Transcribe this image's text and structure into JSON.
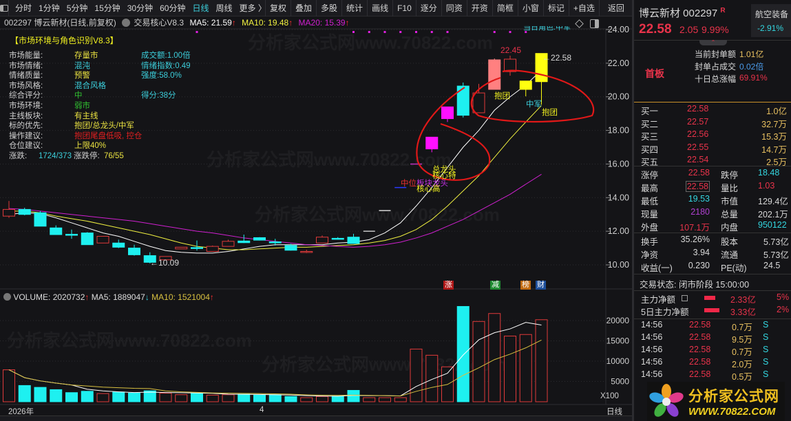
{
  "toolbar": {
    "periods": [
      "分时",
      "1分钟",
      "5分钟",
      "15分钟",
      "30分钟",
      "60分钟",
      "日线",
      "周线",
      "更多 〉"
    ],
    "active_period": "日线",
    "buttons": [
      "复权",
      "叠加",
      "多股",
      "统计",
      "画线",
      "F10",
      "逐分",
      "同资",
      "开资",
      "简框",
      "小窗",
      "标记",
      "+自选"
    ],
    "back": "返回"
  },
  "info": {
    "title": "002297 博云新材(日线,前复权)",
    "indicator": "交易核心V8.3",
    "ma5": "MA5: 21.59",
    "ma10": "MA10: 19.48",
    "ma20": "MA20: 15.39",
    "arrow": "↑"
  },
  "panel": {
    "title": "【市场环境与角色识别V8.3】",
    "rows": [
      {
        "label": "市场能量:",
        "value": "存量市",
        "vcolor": "#e8e040",
        "extra": "成交额:1.00倍"
      },
      {
        "label": "市场情绪:",
        "value": "混沌",
        "vcolor": "#3ccfdc",
        "extra": "情绪指数:0.49"
      },
      {
        "label": "情绪质量:",
        "value": "预警",
        "vcolor": "#e8e040",
        "extra": "强度:58.0%"
      },
      {
        "label": "市场风格:",
        "value": "混合风格",
        "vcolor": "#3ccfdc",
        "extra": ""
      },
      {
        "label": "综合评分:",
        "value": "中",
        "vcolor": "#30c030",
        "extra": "得分:38分"
      },
      {
        "label": "市场环境:",
        "value": "弱市",
        "vcolor": "#30c030",
        "extra": ""
      },
      {
        "label": "主线板块:",
        "value": "有主线",
        "vcolor": "#e8e040",
        "extra": ""
      },
      {
        "label": "标的优先:",
        "value": "抱团/总龙头/中军",
        "vcolor": "#e8e040",
        "extra": ""
      },
      {
        "label": "操作建议:",
        "value": "抱团尾盘低吸, 控仓",
        "vcolor": "#e02020",
        "extra": ""
      },
      {
        "label": "仓位建议:",
        "value": "上限40%",
        "vcolor": "#e8e040",
        "extra": ""
      }
    ],
    "updown_label": "涨跌:",
    "updown_value": "1724/373",
    "limit_label": "涨跌停:",
    "limit_value": "76/55"
  },
  "annotations": {
    "high_label": "22.45",
    "last_label": "22.58",
    "low_label": "10.09",
    "top_role": "当日角色:中军",
    "baotuan1": "抱团",
    "zhongjun": "中军",
    "baotuan2": "抱团",
    "zonglongtou": "总龙头",
    "hexinte": "核心特",
    "zhongwei": "中位",
    "bankuai": "板块龙头",
    "hexingao": "核心高"
  },
  "volume_header": {
    "volume": "VOLUME: 2020732",
    "ma5": "MA5: 1889047",
    "ma10": "MA10: 1521004",
    "up": "↑",
    "down": "↓"
  },
  "event_tags": [
    {
      "text": "涨",
      "color": "#b01818"
    },
    {
      "text": "减",
      "color": "#1d8a30"
    },
    {
      "text": "榜",
      "color": "#c06a10"
    },
    {
      "text": "财",
      "color": "#1d4e9a"
    }
  ],
  "xaxis": {
    "year": "2026年",
    "month": "4",
    "period": "日线",
    "unit": "X100"
  },
  "watermark": "分析家公式网www.70822.com",
  "chart_data": {
    "type": "candlestick",
    "price_axis": {
      "ticks": [
        "24.00",
        "22.00",
        "20.00",
        "18.00",
        "16.00",
        "14.00",
        "12.00",
        "10.00"
      ],
      "range": [
        10,
        24
      ]
    },
    "candles": [
      {
        "o": 12.9,
        "h": 13.8,
        "l": 12.8,
        "c": 13.3,
        "style": "hollow",
        "color": "#e03a3a"
      },
      {
        "o": 13.3,
        "h": 13.4,
        "l": 12.95,
        "c": 13.0,
        "style": "fill",
        "color": "#1ef0f0"
      },
      {
        "o": 13.1,
        "h": 13.2,
        "l": 12.3,
        "c": 12.3,
        "style": "fill",
        "color": "#1ef0f0"
      },
      {
        "o": 12.2,
        "h": 12.35,
        "l": 11.8,
        "c": 11.8,
        "style": "fill",
        "color": "#1ef0f0"
      },
      {
        "o": 11.82,
        "h": 12.1,
        "l": 11.55,
        "c": 11.8,
        "style": "fill",
        "color": "#1ef0f0"
      },
      {
        "o": 11.9,
        "h": 11.95,
        "l": 11.2,
        "c": 11.2,
        "style": "fill",
        "color": "#1ef0f0"
      },
      {
        "o": 11.3,
        "h": 11.7,
        "l": 11.3,
        "c": 11.7,
        "style": "hollow",
        "color": "#e03a3a"
      },
      {
        "o": 11.3,
        "h": 11.5,
        "l": 11.0,
        "c": 11.05,
        "style": "fill",
        "color": "#1ef0f0"
      },
      {
        "o": 11.0,
        "h": 11.2,
        "l": 10.55,
        "c": 10.6,
        "style": "fill",
        "color": "#1ef0f0"
      },
      {
        "o": 10.55,
        "h": 10.75,
        "l": 10.09,
        "c": 10.15,
        "style": "fill",
        "color": "#1ef0f0"
      },
      {
        "o": 10.3,
        "h": 10.5,
        "l": 10.3,
        "c": 10.5,
        "style": "hollow",
        "color": "#e03a3a"
      },
      {
        "o": 10.95,
        "h": 11.05,
        "l": 10.95,
        "c": 11.05,
        "style": "hollow",
        "color": "#e03a3a"
      },
      {
        "o": 11.03,
        "h": 11.45,
        "l": 10.85,
        "c": 10.98,
        "style": "fill",
        "color": "#1ef0f0"
      },
      {
        "o": 10.8,
        "h": 11.15,
        "l": 10.8,
        "c": 11.1,
        "style": "hollow",
        "color": "#e03a3a"
      },
      {
        "o": 11.1,
        "h": 11.5,
        "l": 11.1,
        "c": 11.4,
        "style": "hollow",
        "color": "#e03a3a"
      },
      {
        "o": 11.42,
        "h": 11.8,
        "l": 11.3,
        "c": 11.32,
        "style": "fill",
        "color": "#1ef0f0"
      },
      {
        "o": 11.62,
        "h": 11.65,
        "l": 11.45,
        "c": 11.47,
        "style": "fill",
        "color": "#1ef0f0"
      },
      {
        "o": 11.37,
        "h": 11.55,
        "l": 11.15,
        "c": 11.33,
        "style": "fill",
        "color": "#1ef0f0"
      },
      {
        "o": 11.15,
        "h": 11.25,
        "l": 10.85,
        "c": 10.87,
        "style": "fill",
        "color": "#1ef0f0"
      },
      {
        "o": 10.75,
        "h": 10.9,
        "l": 10.7,
        "c": 10.8,
        "style": "hollow",
        "color": "#e03a3a"
      },
      {
        "o": 11.3,
        "h": 11.75,
        "l": 11.3,
        "c": 11.65,
        "style": "hollow",
        "color": "#e03a3a"
      },
      {
        "o": 11.58,
        "h": 11.65,
        "l": 11.5,
        "c": 11.52,
        "style": "fill",
        "color": "#1ef0f0"
      },
      {
        "o": 11.65,
        "h": 11.85,
        "l": 11.25,
        "c": 11.27,
        "style": "fill",
        "color": "#1ef0f0"
      },
      {
        "o": 12.0,
        "h": 12.0,
        "l": 12.0,
        "c": 12.0,
        "style": "dash",
        "color": "#c8c8c8"
      },
      {
        "o": 13.23,
        "h": 13.23,
        "l": 13.23,
        "c": 13.23,
        "style": "dash",
        "color": "#d8d8d8"
      },
      {
        "o": 14.6,
        "h": 14.6,
        "l": 14.6,
        "c": 14.6,
        "style": "dash",
        "color": "#2a3aff"
      },
      {
        "o": 16.0,
        "h": 16.0,
        "l": 16.0,
        "c": 16.0,
        "style": "dash",
        "color": "#c030c0"
      },
      {
        "o": 16.9,
        "h": 17.6,
        "l": 16.7,
        "c": 17.6,
        "style": "fill",
        "color": "#ff10ff"
      },
      {
        "o": 18.7,
        "h": 19.4,
        "l": 18.5,
        "c": 19.4,
        "style": "fill",
        "color": "#ff10ff"
      },
      {
        "o": 20.64,
        "h": 20.85,
        "l": 18.77,
        "c": 18.9,
        "style": "fill",
        "color": "#1ef0f0"
      },
      {
        "o": 19.05,
        "h": 20.77,
        "l": 19.05,
        "c": 20.23,
        "style": "hollow",
        "color": "#e03a3a"
      },
      {
        "o": 20.44,
        "h": 22.28,
        "l": 20.44,
        "c": 22.2,
        "style": "fill",
        "color": "#ff8080"
      },
      {
        "o": 21.5,
        "h": 22.45,
        "l": 21.26,
        "c": 22.24,
        "style": "hollow",
        "color": "#e03a3a"
      },
      {
        "o": 20.94,
        "h": 20.94,
        "l": 20.03,
        "c": 20.44,
        "style": "fill",
        "color": "#ffff10"
      },
      {
        "o": 20.9,
        "h": 22.58,
        "l": 19.53,
        "c": 22.58,
        "style": "fill",
        "color": "#ffff10"
      }
    ],
    "ma_series": [
      {
        "name": "MA5",
        "color": "#ffffff",
        "values": [
          13.0,
          13.1,
          13.05,
          12.8,
          12.5,
          12.2,
          11.9,
          11.7,
          11.4,
          11.1,
          10.85,
          10.75,
          10.7,
          10.7,
          10.8,
          10.95,
          11.1,
          11.2,
          11.2,
          11.2,
          11.2,
          11.3,
          11.35,
          11.5,
          11.9,
          12.5,
          13.5,
          14.6,
          15.8,
          17.0,
          18.0,
          19.2,
          20.0,
          20.7,
          21.59
        ]
      },
      {
        "name": "MA10",
        "color": "#f0f040",
        "values": [
          13.2,
          13.2,
          13.1,
          12.9,
          12.75,
          12.6,
          12.4,
          12.2,
          12.0,
          11.8,
          11.55,
          11.3,
          11.1,
          11.0,
          10.9,
          10.9,
          10.95,
          11.0,
          11.05,
          11.05,
          11.1,
          11.15,
          11.2,
          11.3,
          11.45,
          11.7,
          12.1,
          12.7,
          13.5,
          14.4,
          15.3,
          16.4,
          17.5,
          18.5,
          19.48
        ]
      },
      {
        "name": "MA20",
        "color": "#d020d0",
        "values": [
          13.35,
          13.3,
          13.2,
          13.1,
          13.0,
          12.9,
          12.8,
          12.7,
          12.6,
          12.45,
          12.3,
          12.15,
          12.0,
          11.9,
          11.75,
          11.6,
          11.5,
          11.4,
          11.3,
          11.2,
          11.15,
          11.1,
          11.05,
          11.1,
          11.2,
          11.35,
          11.6,
          11.9,
          12.3,
          12.7,
          13.2,
          13.7,
          14.2,
          14.8,
          15.39
        ]
      }
    ],
    "signal_dots": [
      12,
      22,
      23,
      24,
      25,
      26,
      27,
      28,
      31,
      32,
      33
    ],
    "volume": {
      "unit": "X100",
      "ticks": [
        "20000",
        "15000",
        "10000",
        "5000"
      ],
      "values": [
        7870,
        4000,
        3540,
        2980,
        2250,
        2580,
        2020,
        2400,
        2130,
        2700,
        2130,
        1740,
        2130,
        1630,
        1740,
        1850,
        1630,
        1740,
        1290,
        1010,
        1290,
        1400,
        2800,
        1010,
        1010,
        1010,
        12980,
        11460,
        8600,
        23480,
        19780,
        21740,
        16180,
        16570,
        20207
      ],
      "ma5": 18890,
      "ma10": 15210
    }
  },
  "quote": {
    "name": "博云新材 002297",
    "badge": "R",
    "price": "22.58",
    "change": "2.05",
    "pct": "9.99%",
    "sector": "航空装备",
    "sector_pct": "-2.91%",
    "board": "首板",
    "seal_rows": [
      {
        "label": "当前封单额",
        "value": "1.01亿",
        "color": "yel"
      },
      {
        "label": "封单占成交",
        "value": "0.02倍",
        "color": "blu"
      },
      {
        "label": "十日总涨幅",
        "value": "69.91%",
        "color": "red"
      }
    ],
    "bids": [
      {
        "label": "买一",
        "price": "22.58",
        "vol": "1.0亿"
      },
      {
        "label": "买二",
        "price": "22.57",
        "vol": "32.7万"
      },
      {
        "label": "买三",
        "price": "22.56",
        "vol": "15.3万"
      },
      {
        "label": "买四",
        "price": "22.55",
        "vol": "14.7万"
      },
      {
        "label": "买五",
        "price": "22.54",
        "vol": "2.5万"
      }
    ],
    "stats": [
      {
        "l1": "涨停",
        "v1": "22.58",
        "c1": "red",
        "l2": "跌停",
        "v2": "18.48",
        "c2": "cyan"
      },
      {
        "l1": "最高",
        "v1": "22.58",
        "c1": "red",
        "l2": "量比",
        "v2": "1.03",
        "c2": "red"
      },
      {
        "l1": "最低",
        "v1": "19.53",
        "c1": "cyan",
        "l2": "市值",
        "v2": "129.4亿",
        "c2": "wht"
      },
      {
        "l1": "现量",
        "v1": "2180",
        "c1": "mag",
        "l2": "总量",
        "v2": "202.1万",
        "c2": "wht"
      },
      {
        "l1": "外盘",
        "v1": "107.1万",
        "c1": "red",
        "l2": "内盘",
        "v2": "950122",
        "c2": "cyan"
      }
    ],
    "stats2": [
      {
        "l1": "换手",
        "v1": "35.26%",
        "l2": "股本",
        "v2": "5.73亿"
      },
      {
        "l1": "净资",
        "v1": "3.94",
        "l2": "流通",
        "v2": "5.73亿"
      },
      {
        "l1": "收益(一)",
        "v1": "0.230",
        "l2": "PE(动)",
        "v2": "24.5"
      }
    ],
    "status": "交易状态: 闭市阶段 15:00:00",
    "flows": [
      {
        "label": "主力净额",
        "value": "2.33亿",
        "pct": "5%",
        "fill": 0.55
      },
      {
        "label": "5日主力净额",
        "value": "3.33亿",
        "pct": "2%",
        "fill": 0.8
      }
    ],
    "ticks": [
      {
        "time": "14:56",
        "price": "22.58",
        "vol": "0.7万",
        "side": "S"
      },
      {
        "time": "14:56",
        "price": "22.58",
        "vol": "9.5万",
        "side": "S"
      },
      {
        "time": "14:56",
        "price": "22.58",
        "vol": "0.7万",
        "side": "S"
      },
      {
        "time": "14:56",
        "price": "22.58",
        "vol": "2.0万",
        "side": "S"
      },
      {
        "time": "14:56",
        "price": "22.58",
        "vol": "0.5万",
        "side": "S"
      }
    ],
    "logo_title": "分析家公式网",
    "logo_url": "WWW.70822.COM"
  }
}
